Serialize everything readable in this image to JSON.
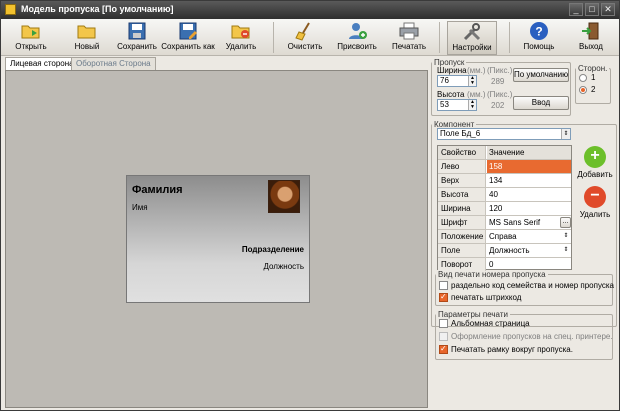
{
  "window": {
    "title": "Модель пропуска [По умолчанию]",
    "minimize": "_",
    "maximize": "□",
    "close": "✕"
  },
  "toolbar": {
    "open": "Открыть",
    "new": "Новый",
    "save": "Сохранить",
    "save_as": "Сохранить как",
    "delete": "Удалить",
    "clear": "Очистить",
    "assign": "Присвоить",
    "print": "Печатать",
    "settings": "Настройки",
    "help": "Помощь",
    "exit": "Выход"
  },
  "tabs": {
    "front": "Лицевая сторона",
    "back": "Оборотная Сторона"
  },
  "card": {
    "surname": "Фамилия",
    "name": "Имя",
    "department": "Подразделение",
    "position": "Должность"
  },
  "pass": {
    "legend": "Пропуск",
    "width_label": "Ширина",
    "width_unit_mm": "(мм.)",
    "width_unit_px": "(Пикс.)",
    "width_value": "76",
    "width_px": "289",
    "height_label": "Высота",
    "height_unit_mm": "(мм.)",
    "height_unit_px": "(Пикс.)",
    "height_value": "53",
    "height_px": "202",
    "default_button": "По умолчанию",
    "enter_button": "Ввод",
    "sides_legend": "Сторон.",
    "side_1": "1",
    "side_2": "2"
  },
  "component": {
    "legend": "Компонент",
    "selected": "Поле Бд_6",
    "header_property": "Свойство",
    "header_value": "Значение",
    "rows": [
      {
        "key": "Лево",
        "value": "158"
      },
      {
        "key": "Верх",
        "value": "134"
      },
      {
        "key": "Высота",
        "value": "40"
      },
      {
        "key": "Ширина",
        "value": "120"
      },
      {
        "key": "Шрифт",
        "value": "MS Sans Serif"
      },
      {
        "key": "Положение",
        "value": "Справа"
      },
      {
        "key": "Поле",
        "value": "Должность"
      },
      {
        "key": "Поворот",
        "value": "0"
      }
    ],
    "font_more": "...",
    "add_label": "Добавить",
    "delete_label": "Удалить"
  },
  "number_print": {
    "legend": "Вид печати номера пропуска",
    "option_separate": "раздельно код семейства и номер пропуска",
    "option_barcode": "печатать штрихкод"
  },
  "print_params": {
    "legend": "Параметры печати",
    "option_album": "Альбомная страница",
    "option_special": "Оформление пропусков на спец. принтере.",
    "option_frame": "Печатать рамку вокруг пропуска."
  },
  "colors": {
    "accent": "#e8652a",
    "add": "#6cbf2a",
    "remove": "#e04a2a",
    "help": "#2a5fc0"
  }
}
